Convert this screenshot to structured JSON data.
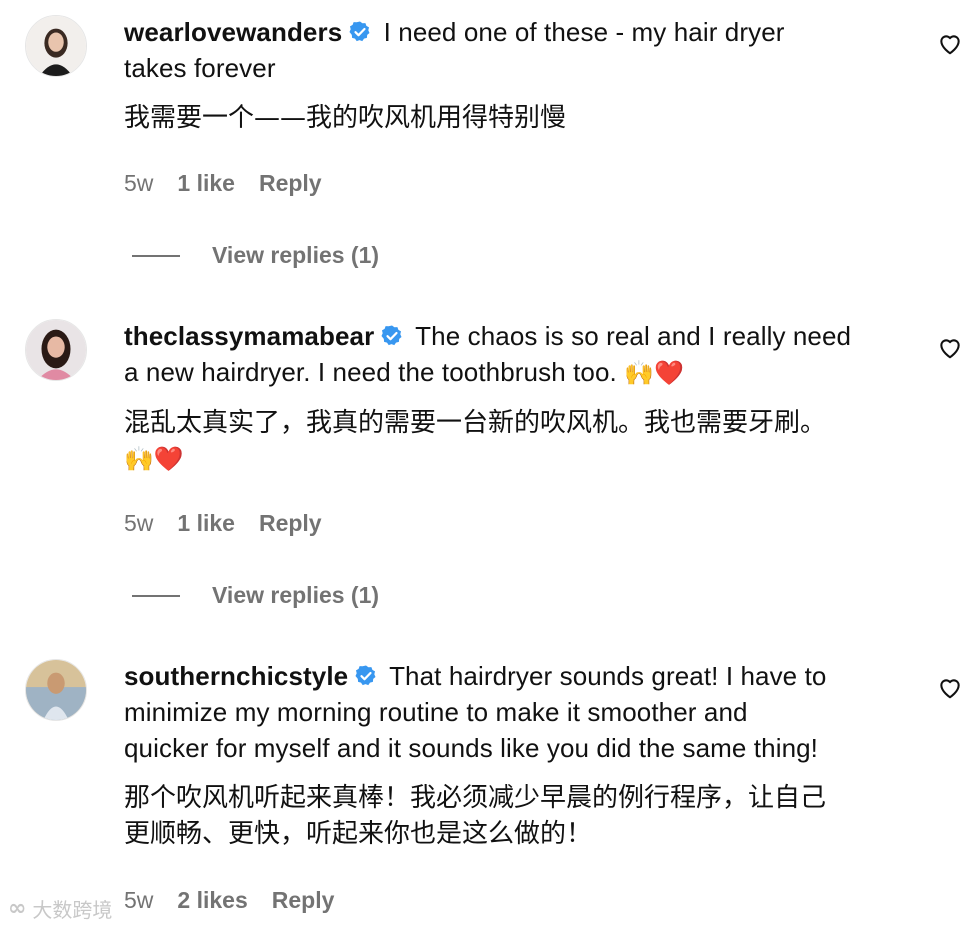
{
  "comments": [
    {
      "username": "wearlovewanders",
      "text_en_1": "I need one of these - my hair dryer",
      "text_en_2": "takes forever",
      "text_zh_1": "我需要一个——我的吹风机用得特别慢",
      "time": "5w",
      "likes": "1 like",
      "reply": "Reply",
      "view_replies": "View replies (1)"
    },
    {
      "username": "theclassymamabear",
      "text_en_1": "The chaos is so real and I really need",
      "text_en_2": "a new hairdryer. I need the toothbrush too.",
      "emoji_en": "🙌❤️",
      "text_zh_1": "混乱太真实了，我真的需要一台新的吹风机。我也需要牙刷。",
      "emoji_zh": "🙌❤️",
      "time": "5w",
      "likes": "1 like",
      "reply": "Reply",
      "view_replies": "View replies (1)"
    },
    {
      "username": "southernchicstyle",
      "text_en_1": "That hairdryer sounds great! I have to",
      "text_en_2": "minimize my morning routine to make it smoother and",
      "text_en_3": "quicker for myself and it sounds like you did the same thing!",
      "text_zh_1": "那个吹风机听起来真棒！我必须减少早晨的例行程序，让自己",
      "text_zh_2": "更顺畅、更快，听起来你也是这么做的！",
      "time": "5w",
      "likes": "2 likes",
      "reply": "Reply"
    }
  ],
  "watermark": {
    "text": "大数跨境"
  },
  "colors": {
    "verified": "#3897f0",
    "meta": "#737373",
    "text": "#111111"
  },
  "icons": {
    "verified": "verified-badge-icon",
    "like": "heart-outline-icon"
  }
}
